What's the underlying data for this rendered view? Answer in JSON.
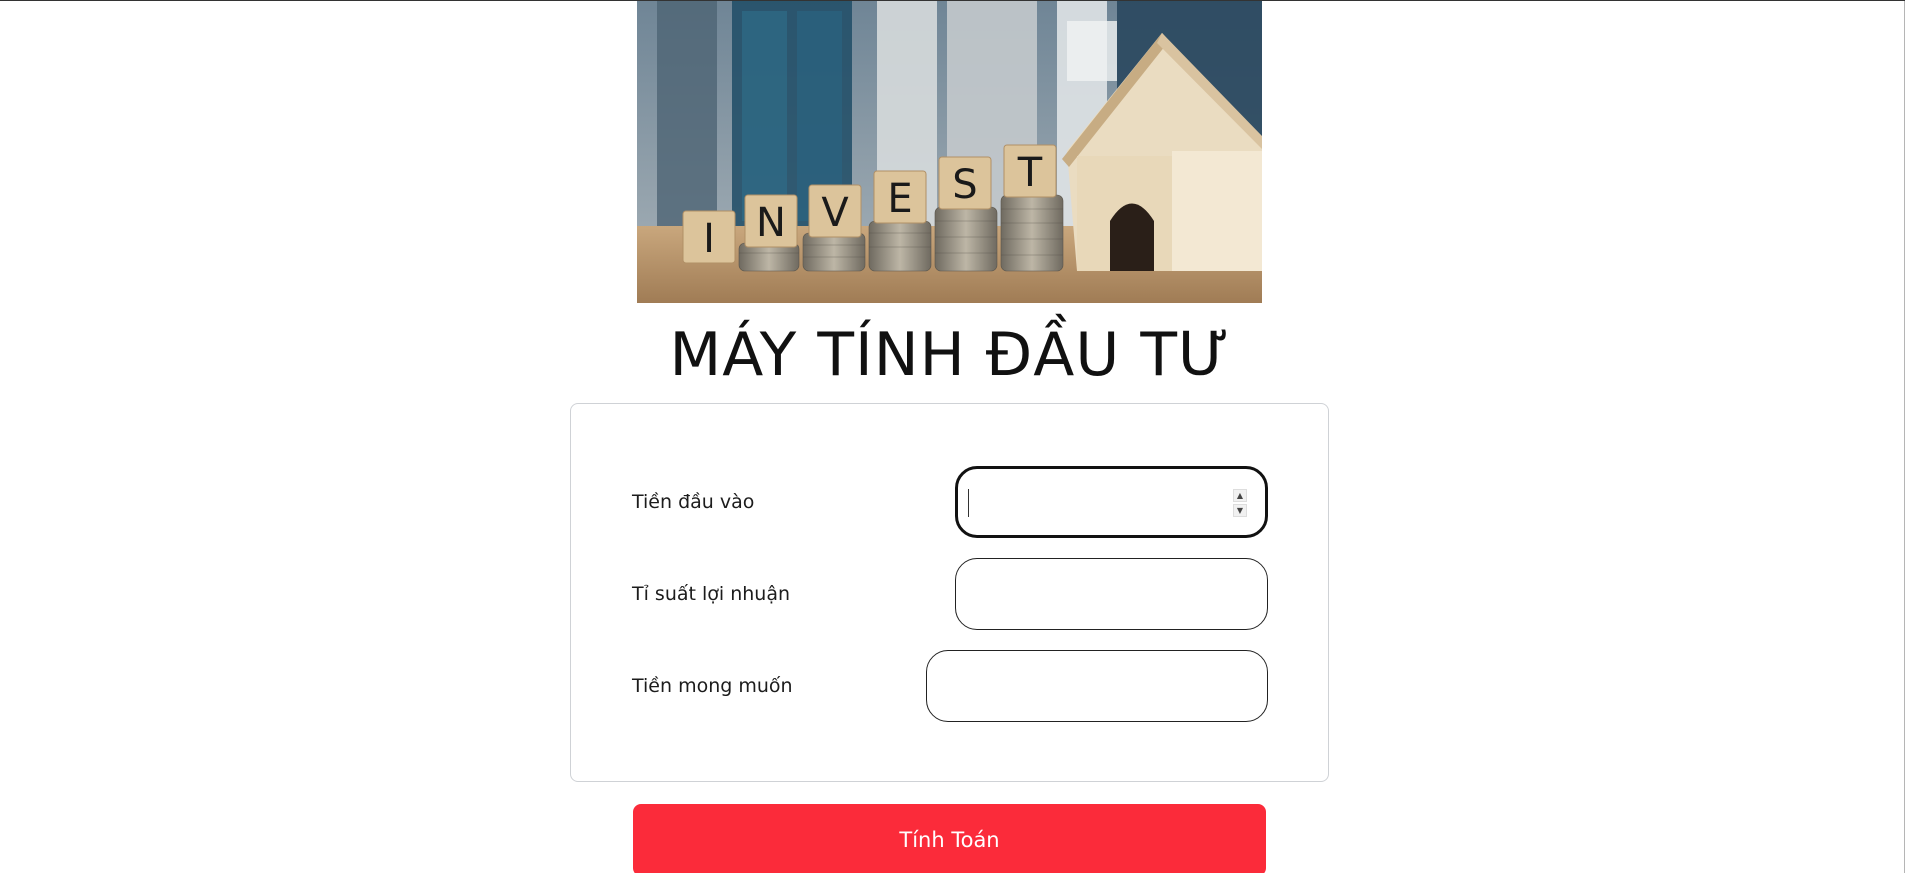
{
  "hero": {
    "tiles": [
      "I",
      "N",
      "V",
      "E",
      "S",
      "T"
    ]
  },
  "page": {
    "title": "MÁY TÍNH ĐẦU TƯ"
  },
  "form": {
    "fields": [
      {
        "label": "Tiền đầu vào",
        "value": ""
      },
      {
        "label": "Tỉ suất lợi nhuận",
        "value": ""
      },
      {
        "label": "Tiền mong muốn",
        "value": ""
      }
    ]
  },
  "actions": {
    "calculate_label": "Tính Toán"
  },
  "colors": {
    "button": "#fb2b3a",
    "card_border": "#cfd2d6"
  }
}
